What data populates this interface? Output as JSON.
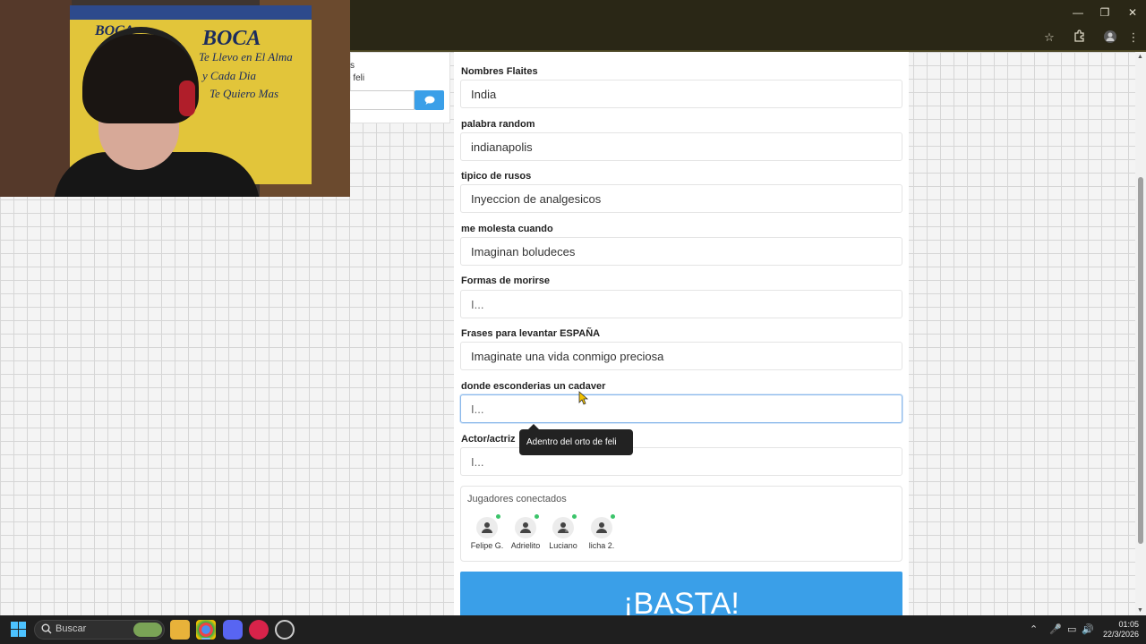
{
  "browser": {
    "window_controls": {
      "minimize": "—",
      "restore": "❐",
      "close": "✕"
    }
  },
  "chat": {
    "line1": "s",
    "line2": "e feli",
    "send_icon": "chat-bubble-icon"
  },
  "form": {
    "fields": [
      {
        "label": "Nombres Flaites",
        "value": "India",
        "placeholder": ""
      },
      {
        "label": "palabra random",
        "value": "indianapolis",
        "placeholder": ""
      },
      {
        "label": "tipico de rusos",
        "value": "Inyeccion de analgesicos",
        "placeholder": ""
      },
      {
        "label": "me molesta cuando",
        "value": "Imaginan boludeces",
        "placeholder": ""
      },
      {
        "label": "Formas de morirse",
        "value": "",
        "placeholder": "I..."
      },
      {
        "label": "Frases para levantar ESPAÑA",
        "value": "Imaginate una vida conmigo preciosa",
        "placeholder": ""
      },
      {
        "label": "donde esconderias un cadaver",
        "value": "",
        "placeholder": "I..."
      },
      {
        "label": "Actor/actriz",
        "value": "",
        "placeholder": "I..."
      }
    ],
    "tooltip": "Adentro del orto de feli"
  },
  "players": {
    "title": "Jugadores conectados",
    "list": [
      {
        "name": "Felipe G."
      },
      {
        "name": "Adrielito"
      },
      {
        "name": "Luciano"
      },
      {
        "name": "licha 2."
      }
    ]
  },
  "basta_button": "¡BASTA!",
  "webcam": {
    "banner_line1": "BOCA",
    "banner_line2": "BOCA",
    "banner_line3": "Te Llevo en El Alma",
    "banner_line4": "y Cada Dia",
    "banner_line5": "Te Quiero Mas"
  },
  "taskbar": {
    "search_placeholder": "Buscar",
    "time": "01:05",
    "date": "22/3/2026"
  },
  "colors": {
    "accent": "#3a9fe8",
    "chrome_bg": "#2a2716",
    "online": "#3bc46a"
  }
}
